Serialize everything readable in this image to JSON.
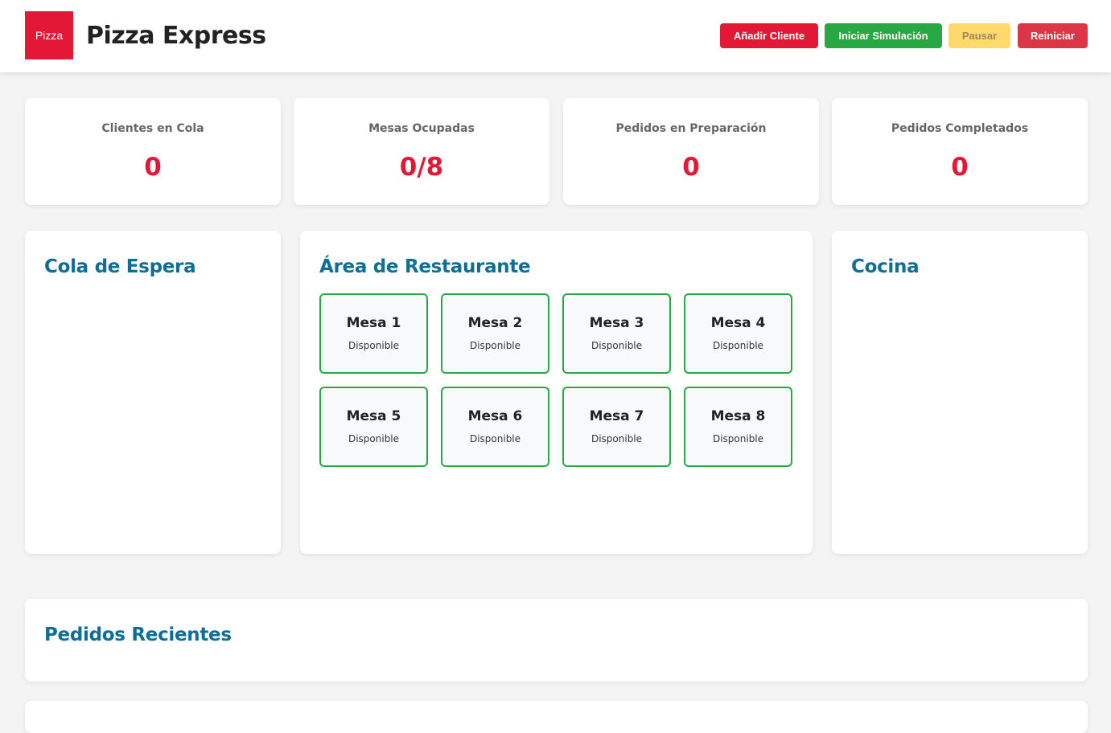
{
  "header": {
    "logo_text": "Pizza",
    "title": "Pizza Express",
    "buttons": {
      "add_client": "Añadir Cliente",
      "start_sim": "Iniciar Simulación",
      "pause": "Pausar",
      "reset": "Reiniciar"
    }
  },
  "stats": [
    {
      "label": "Clientes en Cola",
      "value": "0"
    },
    {
      "label": "Mesas Ocupadas",
      "value": "0/8"
    },
    {
      "label": "Pedidos en Preparación",
      "value": "0"
    },
    {
      "label": "Pedidos Completados",
      "value": "0"
    }
  ],
  "queue": {
    "title": "Cola de Espera"
  },
  "restaurant": {
    "title": "Área de Restaurante",
    "tables": [
      {
        "name": "Mesa 1",
        "status": "Disponible"
      },
      {
        "name": "Mesa 2",
        "status": "Disponible"
      },
      {
        "name": "Mesa 3",
        "status": "Disponible"
      },
      {
        "name": "Mesa 4",
        "status": "Disponible"
      },
      {
        "name": "Mesa 5",
        "status": "Disponible"
      },
      {
        "name": "Mesa 6",
        "status": "Disponible"
      },
      {
        "name": "Mesa 7",
        "status": "Disponible"
      },
      {
        "name": "Mesa 8",
        "status": "Disponible"
      }
    ]
  },
  "kitchen": {
    "title": "Cocina"
  },
  "recent_orders": {
    "title": "Pedidos Recientes"
  },
  "colors": {
    "brand": "#e31837",
    "accent_title": "#0d6e96",
    "available": "#28a745",
    "pause": "#ffda6a",
    "reset": "#dc3545"
  }
}
